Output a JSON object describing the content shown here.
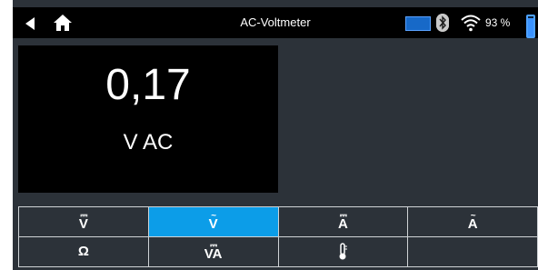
{
  "header": {
    "title": "AC-Voltmeter",
    "battery_percent": "93 %"
  },
  "reading": {
    "value": "0,17",
    "unit": "V AC"
  },
  "modes": [
    {
      "mark": "⎓",
      "letter": "V",
      "active": false
    },
    {
      "mark": "~",
      "letter": "V",
      "active": true
    },
    {
      "mark": "⎓",
      "letter": "A",
      "active": false
    },
    {
      "mark": "~",
      "letter": "A",
      "active": false
    },
    {
      "mark": "",
      "letter": "Ω",
      "active": false
    },
    {
      "mark": "⎓",
      "letter": "VA",
      "active": false
    },
    {
      "mark": "",
      "letter": "",
      "active": false
    },
    {
      "mark": "",
      "letter": "",
      "active": false
    }
  ],
  "colors": {
    "accent": "#0c9de8",
    "background": "#2c3239",
    "status_bar": "#000000",
    "battery": "#3b93ff"
  },
  "icons": {
    "back": "back-arrow-icon",
    "home": "home-icon",
    "battery_tester": "battery-tester-icon",
    "bluetooth": "bluetooth-icon",
    "wifi": "wifi-icon",
    "battery": "battery-icon",
    "temperature": "thermometer-icon"
  },
  "battery_level": 0.93
}
